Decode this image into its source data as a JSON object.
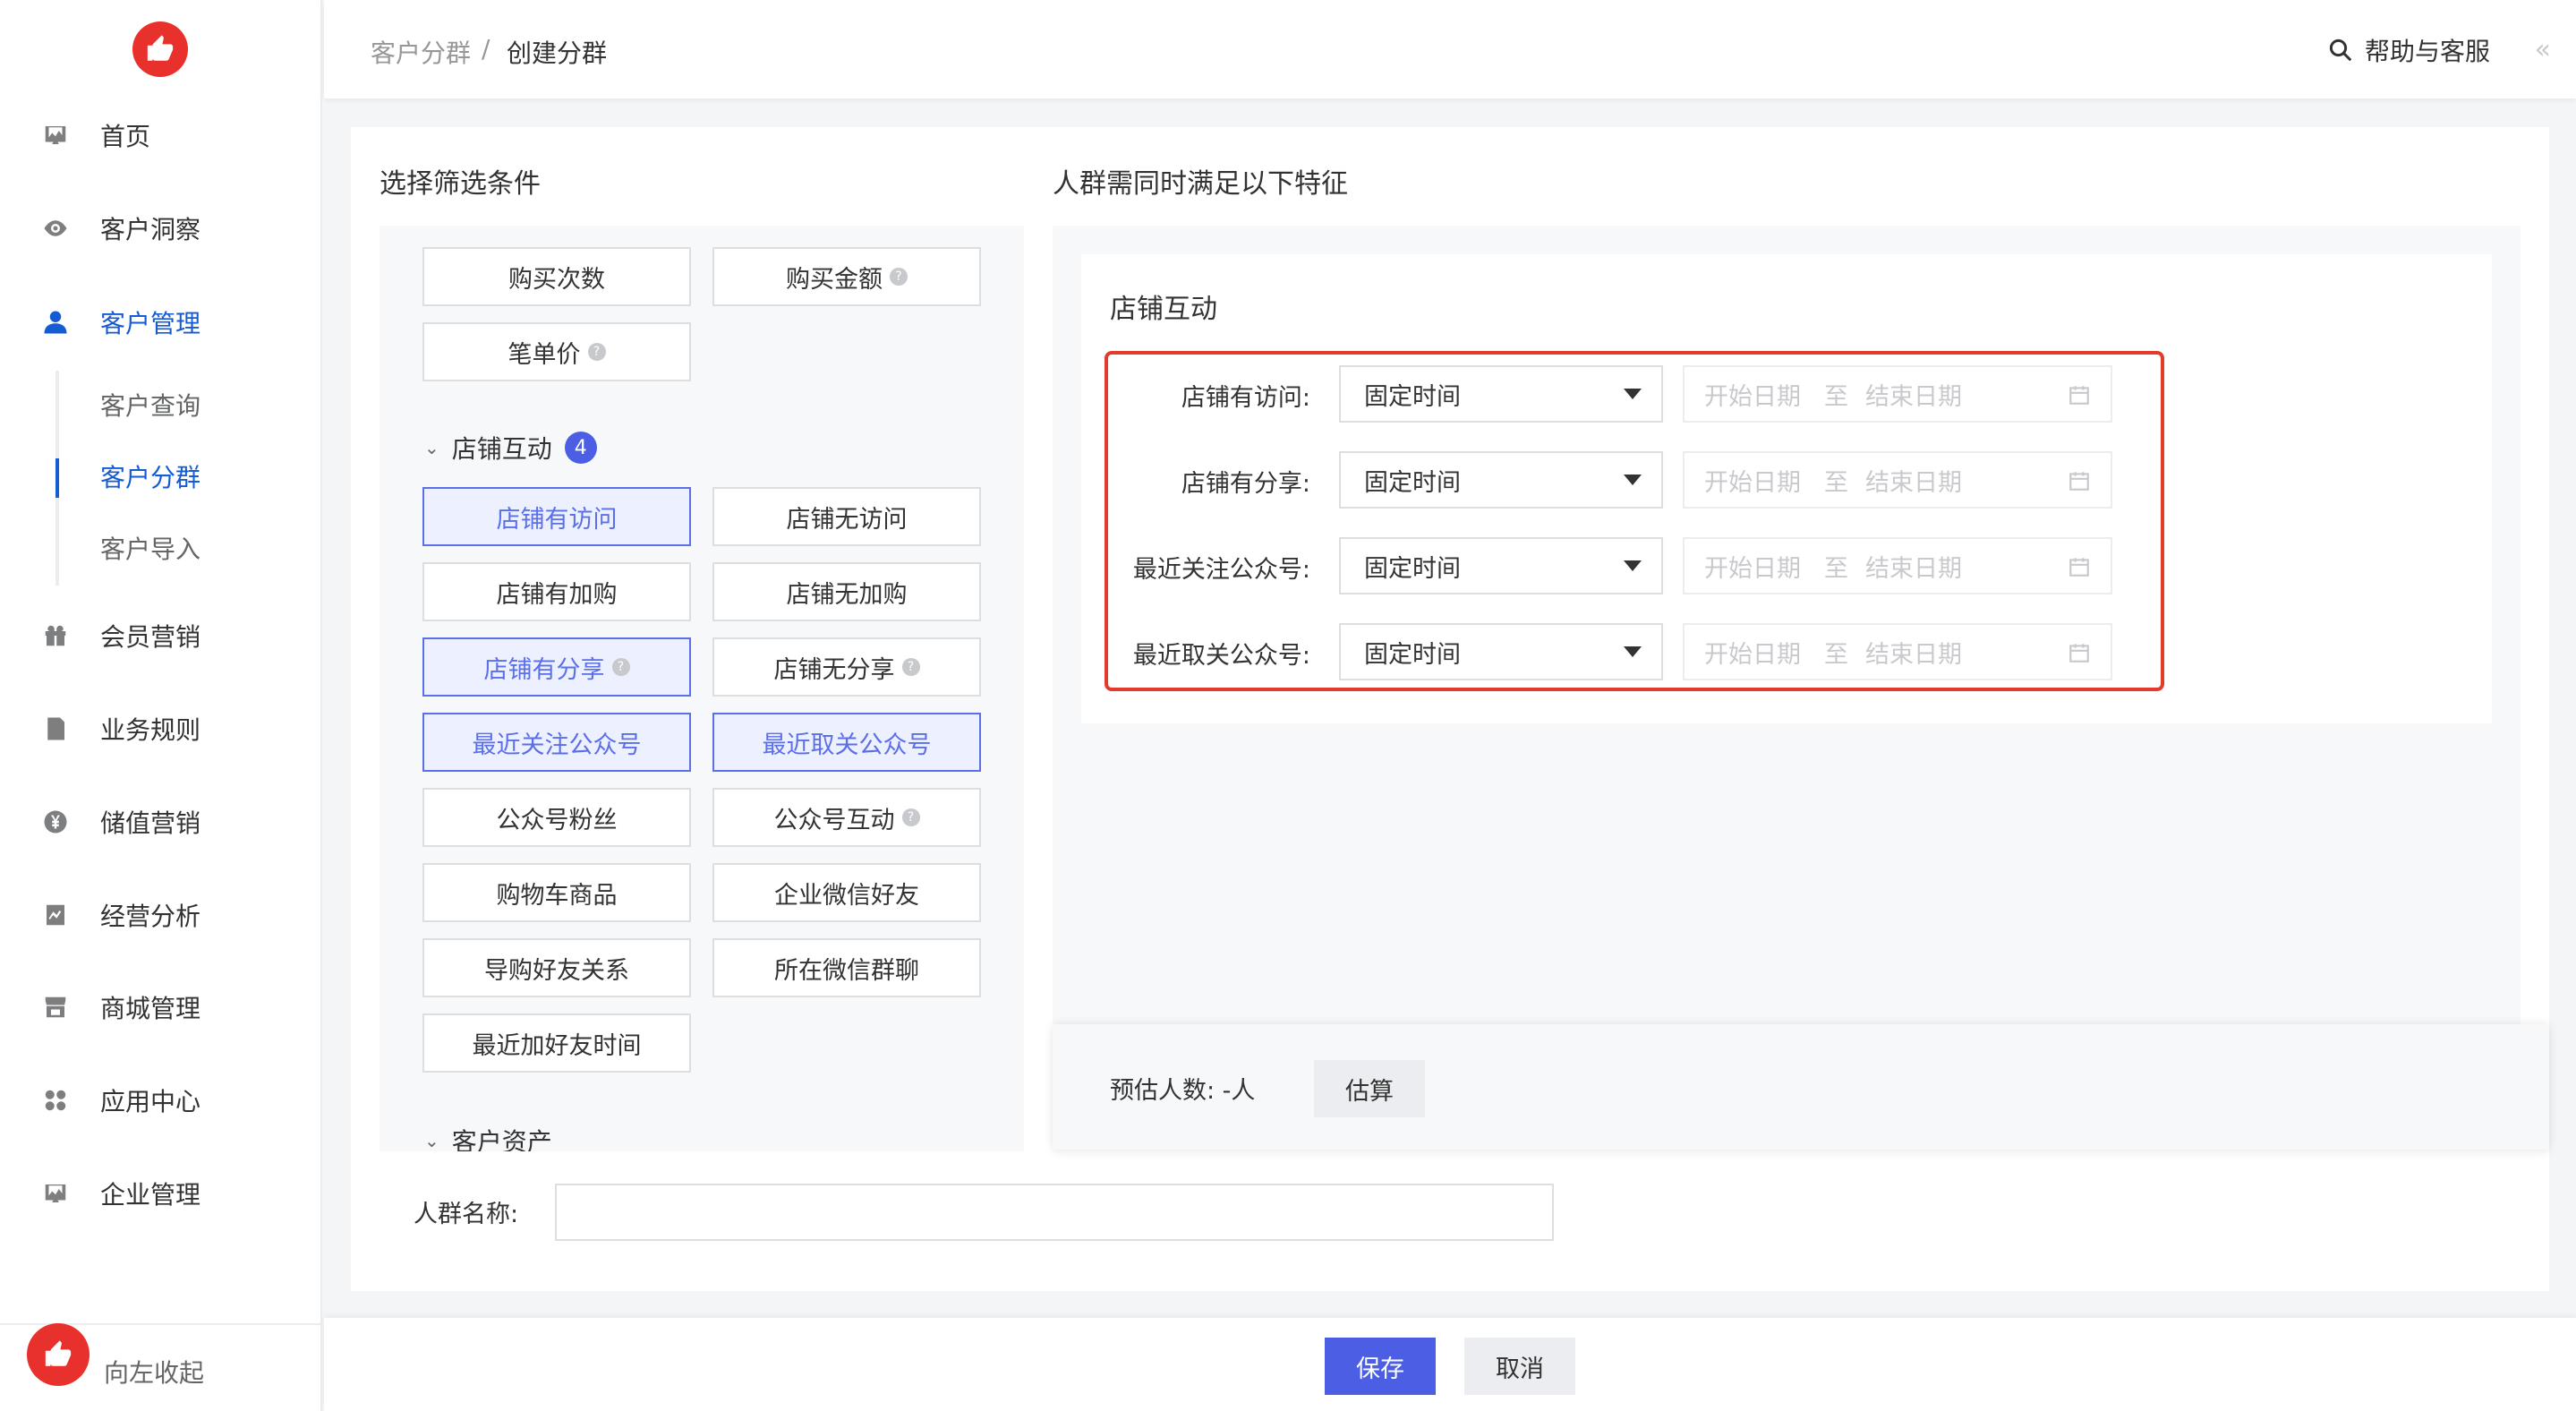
{
  "sidebar": {
    "items": [
      {
        "label": "首页",
        "icon": "dashboard-icon"
      },
      {
        "label": "客户洞察",
        "icon": "eye-icon"
      },
      {
        "label": "客户管理",
        "icon": "user-icon"
      },
      {
        "label": "会员营销",
        "icon": "gift-icon"
      },
      {
        "label": "业务规则",
        "icon": "document-icon"
      },
      {
        "label": "储值营销",
        "icon": "yen-coin-icon"
      },
      {
        "label": "经营分析",
        "icon": "chart-icon"
      },
      {
        "label": "商城管理",
        "icon": "store-icon"
      },
      {
        "label": "应用中心",
        "icon": "apps-icon"
      },
      {
        "label": "企业管理",
        "icon": "enterprise-icon"
      }
    ],
    "subitems": [
      "客户查询",
      "客户分群",
      "客户导入"
    ],
    "collapse_label": "向左收起"
  },
  "topbar": {
    "breadcrumb": [
      "客户分群",
      "创建分群"
    ],
    "separator": "/",
    "help_label": "帮助与客服",
    "collapse_glyph": "«"
  },
  "filter": {
    "title": "选择筛选条件",
    "top_buttons": [
      "购买次数",
      "购买金额",
      "笔单价"
    ],
    "group_name": "店铺互动",
    "group_count": "4",
    "buttons": [
      "店铺有访问",
      "店铺无访问",
      "店铺有加购",
      "店铺无加购",
      "店铺有分享",
      "店铺无分享",
      "最近关注公众号",
      "最近取关公众号",
      "公众号粉丝",
      "公众号互动",
      "购物车商品",
      "企业微信好友",
      "导购好友关系",
      "所在微信群聊",
      "最近加好友时间"
    ],
    "selected": [
      "店铺有访问",
      "店铺有分享",
      "最近关注公众号",
      "最近取关公众号"
    ],
    "next_group": "客户资产"
  },
  "conditions": {
    "title": "人群需同时满足以下特征",
    "card_title": "店铺互动",
    "rows": [
      {
        "label": "店铺有访问:",
        "select": "固定时间",
        "start": "开始日期",
        "sep": "至",
        "end": "结束日期"
      },
      {
        "label": "店铺有分享:",
        "select": "固定时间",
        "start": "开始日期",
        "sep": "至",
        "end": "结束日期"
      },
      {
        "label": "最近关注公众号:",
        "select": "固定时间",
        "start": "开始日期",
        "sep": "至",
        "end": "结束日期"
      },
      {
        "label": "最近取关公众号:",
        "select": "固定时间",
        "start": "开始日期",
        "sep": "至",
        "end": "结束日期"
      }
    ],
    "highlight_color": "#e33a2c"
  },
  "estimate": {
    "label": "预估人数: -人",
    "button": "估算"
  },
  "name_field": {
    "label": "人群名称:",
    "value": ""
  },
  "footer": {
    "save": "保存",
    "cancel": "取消"
  },
  "colors": {
    "primary": "#4b5ee4",
    "nav_active": "#155bd4",
    "brand": "#e8312c"
  }
}
